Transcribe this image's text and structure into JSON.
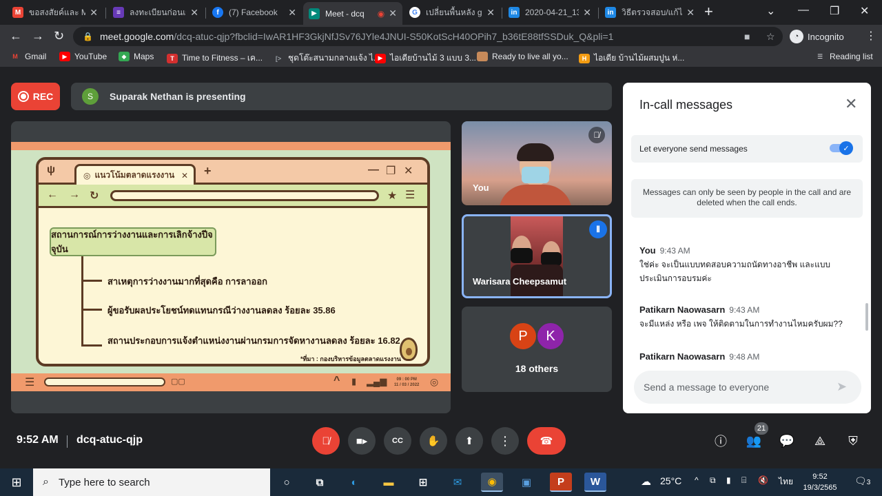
{
  "browser": {
    "tabs": [
      {
        "title": "ขอสงสัยค์และ Me",
        "icon": "gmail-icon",
        "color": "#ea4335"
      },
      {
        "title": "ลงทะเบียนก่อนเข้",
        "icon": "forms-icon",
        "color": "#673ab7"
      },
      {
        "title": "(7) Facebook",
        "icon": "facebook-icon",
        "color": "#1877f2"
      },
      {
        "title": "Meet - dcq",
        "icon": "meet-icon",
        "color": "#00897b",
        "active": true
      },
      {
        "title": "เปลี่ยนพื้นหลัง gc",
        "icon": "google-icon",
        "color": "#4285f4"
      },
      {
        "title": "2020-04-21_13",
        "icon": "infographic-icon",
        "color": "#1e88e5"
      },
      {
        "title": "วิธีตรวจสอบ/แก้ไ",
        "icon": "infographic-icon",
        "color": "#1e88e5"
      }
    ],
    "url_host": "meet.google.com",
    "url_path": "/dcq-atuc-qjp?fbclid=IwAR1HF3GkjNfJSv76JYle4JNUI-S50KotScH40OPih7_b36tE88tfSSDuk_Q&pli=1",
    "incognito_label": "Incognito",
    "bookmarks": [
      {
        "label": "Gmail",
        "icon": "gmail-icon",
        "color": "#ea4335"
      },
      {
        "label": "YouTube",
        "icon": "youtube-icon",
        "color": "#ff0000"
      },
      {
        "label": "Maps",
        "icon": "maps-icon",
        "color": "#34a853"
      },
      {
        "label": "Time to Fitness – เค...",
        "icon": "fitness-icon",
        "color": "#d32f2f"
      },
      {
        "label": "ชุดโต๊ะสนามกลางแจ้ง ไ...",
        "icon": "page-icon",
        "color": "#9aa0a6"
      },
      {
        "label": "ไอเดียบ้านไม้ 3 แบบ 3...",
        "icon": "youtube-icon",
        "color": "#ff0000"
      },
      {
        "label": "Ready to live all yo...",
        "icon": "image-icon",
        "color": "#c78a5a"
      },
      {
        "label": "ไอเดีย บ้านไม้ผสมปูน ห่...",
        "icon": "h-icon",
        "color": "#f39c12"
      }
    ],
    "reading_list": "Reading list"
  },
  "meet": {
    "rec_label": "REC",
    "presenter_initial": "S",
    "presenting_text": "Suparak Nethan is presenting",
    "slide": {
      "tab_title": "แนวโน้มตลาดแรงงาน",
      "heading": "สถานการณ์การว่างงานและการเลิกจ้างปีจจุบัน",
      "bullets": [
        "สาเหตุการว่างงานมากที่สุดคือ การลาออก",
        "ผู้ขอรับผลประโยชน์ทดแทนกรณีว่างงานลดลง ร้อยละ 35.86",
        "สถานประกอบการแจ้งตำแหน่งงานผ่านกรมการจัดหางานลดลง ร้อยละ 16.82"
      ],
      "source": "*ที่มา : กองบริหารข้อมูลตลาดแรงงาน",
      "footer_time": "09 : 00 PM",
      "footer_date": "11 / 03 / 2022"
    },
    "tiles": {
      "you_label": "You",
      "speaker_label": "Warisara Cheepsamut",
      "others_initials": [
        "P",
        "K"
      ],
      "others_colors": [
        "#d84315",
        "#8e24aa"
      ],
      "others_label": "18 others"
    },
    "chat": {
      "title": "In-call messages",
      "toggle_label": "Let everyone send messages",
      "toggle_on": true,
      "info": "Messages can only be seen by people in the call and are deleted when the call ends.",
      "messages": [
        {
          "sender": "You",
          "time": "9:43 AM",
          "text": "ใช่ค่ะ จะเป็นแบบทดสอบความถนัดทางอาชีพ และแบบประเมินการอบรมค่ะ"
        },
        {
          "sender": "Patikarn Naowasarn",
          "time": "9:43 AM",
          "text": "จะมีแหล่ง หรือ เพจ ให้ติดตามในการทำงานไหมครับผม??"
        },
        {
          "sender": "Patikarn Naowasarn",
          "time": "9:48 AM",
          "text": ""
        }
      ],
      "input_placeholder": "Send a message to everyone"
    },
    "clock": "9:52 AM",
    "meeting_code": "dcq-atuc-qjp",
    "participants_count": "21"
  },
  "taskbar": {
    "search_placeholder": "Type here to search",
    "weather": "25°C",
    "lang": "ไทย",
    "time": "9:52",
    "date": "19/3/2565",
    "notifications": "3"
  }
}
